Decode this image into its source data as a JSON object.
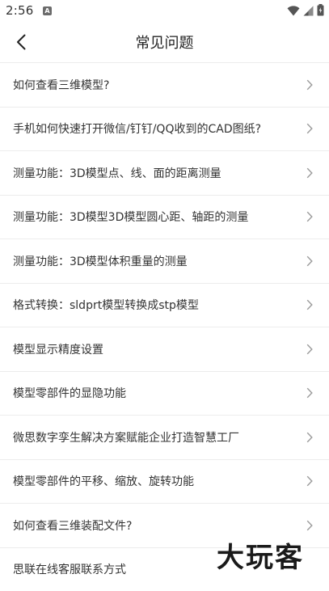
{
  "status_bar": {
    "time": "2:56",
    "notification_badge": "A"
  },
  "header": {
    "title": "常见问题"
  },
  "faq_items": [
    {
      "label": "如何查看三维模型?"
    },
    {
      "label": "手机如何快速打开微信/钉钉/QQ收到的CAD图纸?"
    },
    {
      "label": "测量功能：3D模型点、线、面的距离测量"
    },
    {
      "label": "测量功能：3D模型3D模型圆心距、轴距的测量"
    },
    {
      "label": "测量功能：3D模型体积重量的测量"
    },
    {
      "label": "格式转换：sldprt模型转换成stp模型"
    },
    {
      "label": "模型显示精度设置"
    },
    {
      "label": "模型零部件的显隐功能"
    },
    {
      "label": "微思数字孪生解决方案赋能企业打造智慧工厂"
    },
    {
      "label": "模型零部件的平移、缩放、旋转功能"
    },
    {
      "label": "如何查看三维装配文件?"
    },
    {
      "label": "思联在线客服联系方式"
    }
  ],
  "watermark": {
    "text": "大玩客"
  },
  "colors": {
    "background": "#ffffff",
    "divider": "#ececec",
    "text": "#333333",
    "chevron": "#9a9a9a"
  },
  "icons": {
    "back": "back-arrow-icon",
    "row": "chevron-right-icon"
  }
}
